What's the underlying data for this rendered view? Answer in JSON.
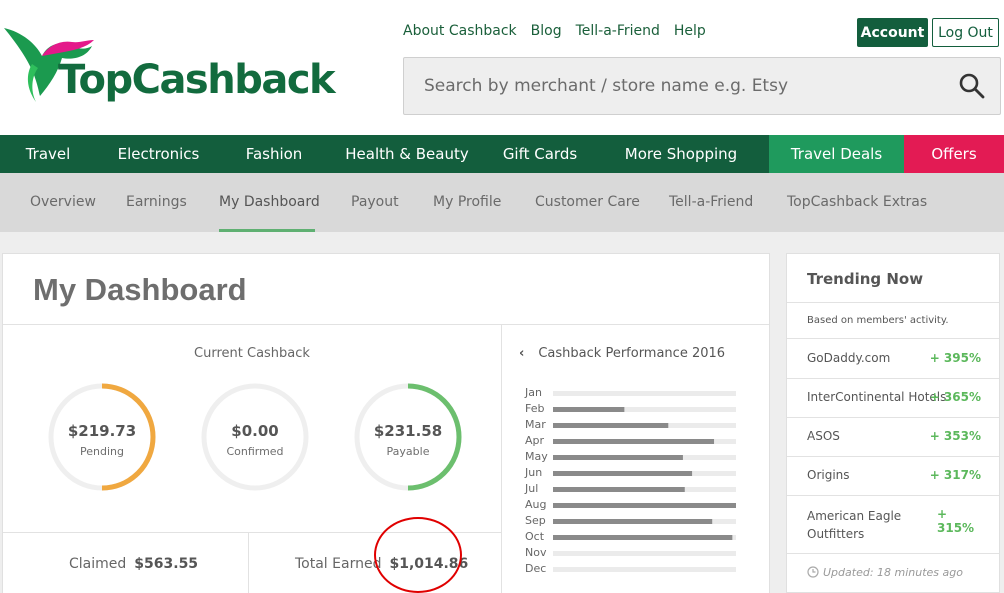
{
  "brand": {
    "name": "TopCashback",
    "primary": "#135e3d",
    "accent": "#e31b54"
  },
  "header": {
    "links": [
      "About Cashback",
      "Blog",
      "Tell-a-Friend",
      "Help"
    ],
    "account_label": "Account",
    "logout_label": "Log Out",
    "search_placeholder": "Search by merchant / store name e.g. Etsy"
  },
  "mainnav": [
    {
      "label": "Travel",
      "w": 96
    },
    {
      "label": "Electronics",
      "w": 125
    },
    {
      "label": "Fashion",
      "w": 106
    },
    {
      "label": "Health & Beauty",
      "w": 160
    },
    {
      "label": "Gift Cards",
      "w": 106
    },
    {
      "label": "More Shopping",
      "w": 176
    },
    {
      "label": "Travel Deals",
      "w": 135
    },
    {
      "label": "Offers",
      "w": 100
    }
  ],
  "subnav": {
    "items": [
      "Overview",
      "Earnings",
      "My Dashboard",
      "Payout",
      "My Profile",
      "Customer Care",
      "Tell-a-Friend",
      "TopCashback Extras"
    ],
    "active": "My Dashboard"
  },
  "dashboard": {
    "title": "My Dashboard",
    "current_cashback_label": "Current Cashback",
    "rings": [
      {
        "value": "$219.73",
        "label": "Pending",
        "color": "#f0a840",
        "fraction": 0.5
      },
      {
        "value": "$0.00",
        "label": "Confirmed",
        "color": "#f0f0f0",
        "fraction": 0
      },
      {
        "value": "$231.58",
        "label": "Payable",
        "color": "#6cbf6e",
        "fraction": 0.5
      }
    ],
    "claimed_label": "Claimed",
    "claimed_value": "$563.55",
    "total_label": "Total Earned",
    "total_value": "$1,014.86"
  },
  "performance": {
    "title": "Cashback Performance 2016"
  },
  "chart_data": {
    "type": "bar",
    "title": "Cashback Performance 2016",
    "categories": [
      "Jan",
      "Feb",
      "Mar",
      "Apr",
      "May",
      "Jun",
      "Jul",
      "Aug",
      "Sep",
      "Oct",
      "Nov",
      "Dec"
    ],
    "values": [
      0,
      0.39,
      0.63,
      0.88,
      0.71,
      0.76,
      0.72,
      1.0,
      0.87,
      0.98,
      0,
      0
    ],
    "xlim": [
      0,
      1
    ]
  },
  "trending": {
    "title": "Trending Now",
    "subtitle": "Based on members' activity.",
    "items": [
      {
        "name": "GoDaddy.com",
        "pct": "+ 395%"
      },
      {
        "name": "InterContinental Hotels",
        "pct": "+ 365%"
      },
      {
        "name": "ASOS",
        "pct": "+ 353%"
      },
      {
        "name": "Origins",
        "pct": "+ 317%"
      },
      {
        "name": "American Eagle Outfitters",
        "pct": "+ 315%"
      }
    ],
    "updated": "Updated: 18 minutes ago"
  }
}
